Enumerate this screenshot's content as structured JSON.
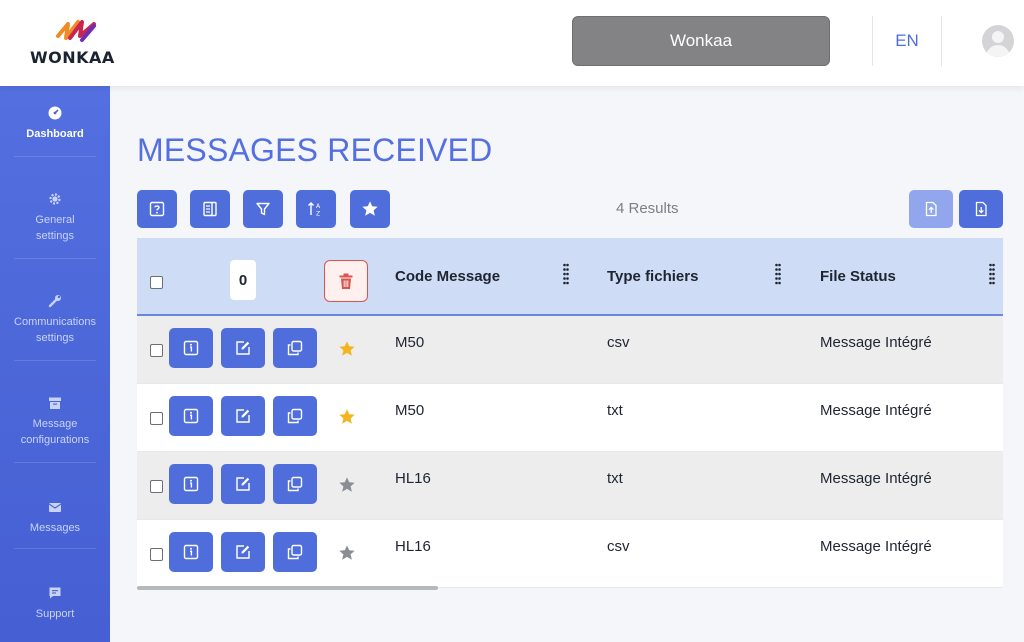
{
  "brand": {
    "name": "WONKAA"
  },
  "header": {
    "user_label": "Wonkaa",
    "language": "EN"
  },
  "sidebar": {
    "items": [
      {
        "label": "Dashboard",
        "icon": "dashboard-icon",
        "active": true
      },
      {
        "label": "General settings",
        "icon": "gear-icon",
        "active": false
      },
      {
        "label": "Communications settings",
        "icon": "wrench-icon",
        "active": false
      },
      {
        "label": "Message configurations",
        "icon": "archive-icon",
        "active": false
      },
      {
        "label": "Messages",
        "icon": "envelope-icon",
        "active": false
      },
      {
        "label": "Support",
        "icon": "chat-icon",
        "active": false
      }
    ]
  },
  "main": {
    "title": "MESSAGES RECEIVED",
    "toolbar": {
      "buttons": [
        "help-icon",
        "columns-icon",
        "filter-icon",
        "sort-icon",
        "star-icon"
      ],
      "results": "4 Results",
      "right_buttons": [
        "upload-icon",
        "download-icon"
      ]
    },
    "table": {
      "selected_count": "0",
      "columns": [
        "Code Message",
        "Type fichiers",
        "File Status"
      ],
      "rows": [
        {
          "code": "M50",
          "type": "csv",
          "status": "Message Intégré",
          "favorite": true
        },
        {
          "code": "M50",
          "type": "txt",
          "status": "Message Intégré",
          "favorite": true
        },
        {
          "code": "HL16",
          "type": "txt",
          "status": "Message Intégré",
          "favorite": false
        },
        {
          "code": "HL16",
          "type": "csv",
          "status": "Message Intégré",
          "favorite": false
        }
      ]
    }
  },
  "colors": {
    "accent": "#4f6edb",
    "sidebar": "#4c67d8",
    "header_row": "#cfdcf6",
    "star_active": "#f2b51e",
    "star_inactive": "#8a8d93",
    "danger": "#d9534f"
  }
}
